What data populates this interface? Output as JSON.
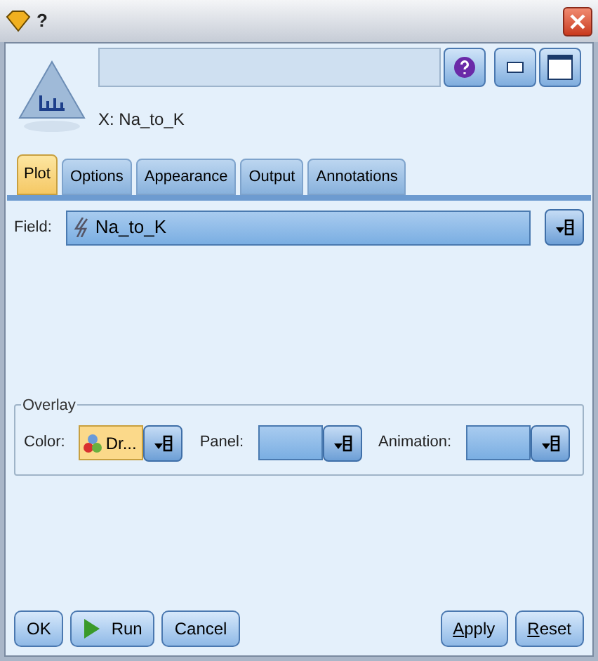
{
  "window": {
    "title": "?"
  },
  "header": {
    "node_label": "X: Na_to_K"
  },
  "tabs": [
    {
      "label": "Plot",
      "selected": true
    },
    {
      "label": "Options",
      "selected": false
    },
    {
      "label": "Appearance",
      "selected": false
    },
    {
      "label": "Output",
      "selected": false
    },
    {
      "label": "Annotations",
      "selected": false
    }
  ],
  "field": {
    "label": "Field:",
    "value": "Na_to_K"
  },
  "overlay": {
    "title": "Overlay",
    "selectors": [
      {
        "label": "Color:",
        "value": "Dr...",
        "highlighted": true
      },
      {
        "label": "Panel:",
        "highlighted": false
      },
      {
        "label": "Animation:",
        "highlighted": false
      }
    ]
  },
  "buttons": [
    {
      "label": "OK",
      "kind": "plain",
      "underline_first": false
    },
    {
      "label": "Run",
      "kind": "run",
      "underline_first": false
    },
    {
      "label": "Cancel",
      "kind": "plain",
      "underline_first": false
    },
    {
      "label": "Apply",
      "kind": "plain",
      "underline_first": true
    },
    {
      "label": "Reset",
      "kind": "plain",
      "underline_first": true
    }
  ]
}
